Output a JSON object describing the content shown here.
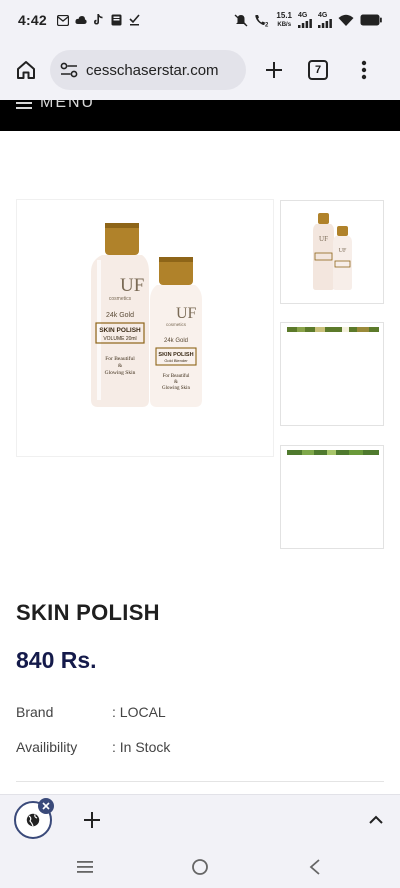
{
  "status_bar": {
    "time": "4:42",
    "net_speed": "15.1",
    "net_unit": "KB/s",
    "network_1": "4G",
    "network_2": "4G"
  },
  "browser": {
    "url": "cesschaserstar.com",
    "tab_count": "7"
  },
  "site_nav": {
    "menu_label": "MENU"
  },
  "product": {
    "title": "SKIN POLISH",
    "price": "840 Rs.",
    "specs": [
      {
        "label": "Brand",
        "value": ": LOCAL"
      },
      {
        "label": "Availibility",
        "value": ": In Stock"
      }
    ],
    "bottle_large": {
      "brand": "UF",
      "sub": "cosmetics",
      "line": "24k Gold",
      "name": "SKIN POLISH",
      "volume": "VOLUME 20ml",
      "tag1": "For Beautiful",
      "tag2": "&",
      "tag3": "Glowing Skin"
    },
    "bottle_small": {
      "brand": "UF",
      "sub": "cosmetics",
      "line": "24k Gold",
      "name": "SKIN POLISH",
      "volume": "Gold Blender",
      "tag1": "For Beautiful",
      "tag2": "&",
      "tag3": "Glowing Skin"
    }
  },
  "colors": {
    "price": "#141a4a",
    "cap_gold": "#b0822a",
    "bottle": "#f6ece6",
    "foliage": "#5c7a2a"
  }
}
